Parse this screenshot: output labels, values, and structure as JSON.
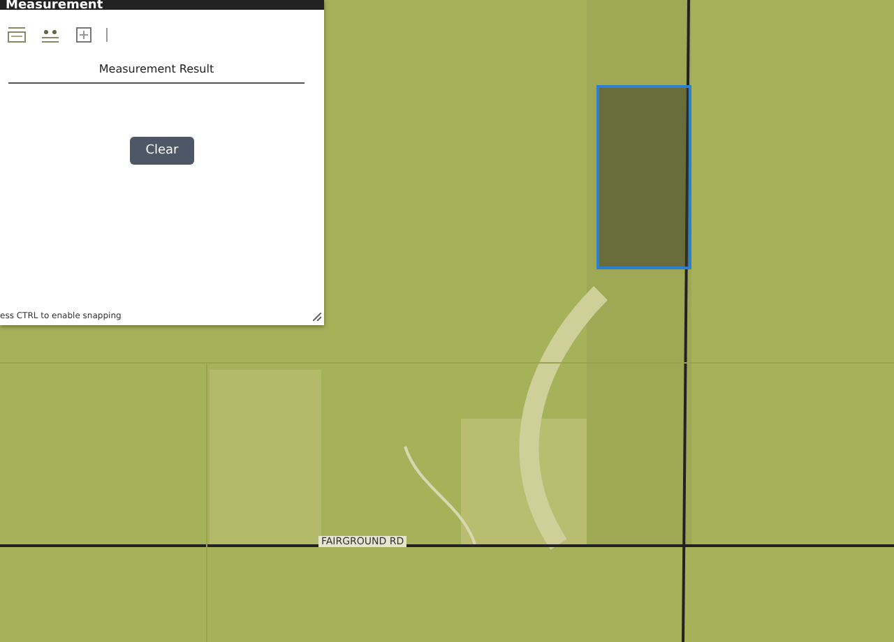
{
  "panel": {
    "title": "Measurement",
    "tools": [
      {
        "kind": "area",
        "selected": false
      },
      {
        "kind": "distance",
        "selected": false
      },
      {
        "kind": "location",
        "selected": false
      }
    ],
    "result_heading": "Measurement Result",
    "clear_button": "Clear",
    "hint": "ess CTRL to enable snapping"
  },
  "map": {
    "road_label": "FAIRGROUND RD"
  }
}
